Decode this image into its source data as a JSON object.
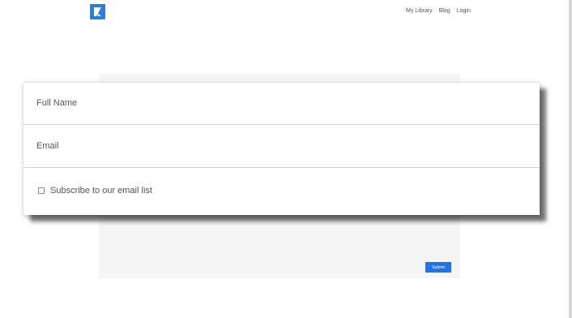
{
  "header": {
    "logo_icon": "kajabi-logo-icon",
    "nav": [
      "My Library",
      "Blog",
      "Login"
    ]
  },
  "form": {
    "submit_label": "Submit"
  },
  "popup": {
    "full_name_label": "Full Name",
    "email_label": "Email",
    "subscribe_label": "Subscribe to our email list",
    "subscribe_checked": false
  },
  "colors": {
    "accent": "#2a7de1",
    "button": "#1f74e6",
    "panel": "#f5f5f5"
  }
}
